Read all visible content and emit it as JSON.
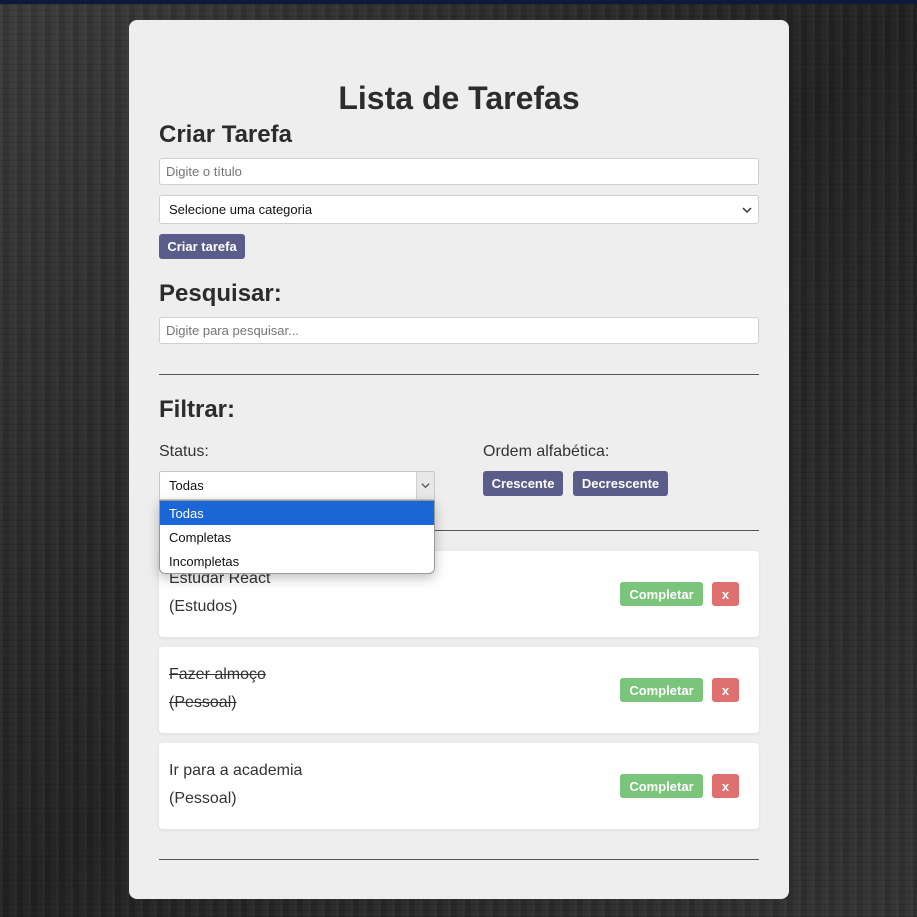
{
  "app": {
    "title": "Lista de Tarefas"
  },
  "create": {
    "heading": "Criar Tarefa",
    "title_placeholder": "Digite o título",
    "category_selected": "Selecione uma categoria",
    "button_label": "Criar tarefa"
  },
  "search": {
    "heading": "Pesquisar:",
    "placeholder": "Digite para pesquisar..."
  },
  "filter": {
    "heading": "Filtrar:",
    "status_label": "Status:",
    "status_selected": "Todas",
    "status_options": [
      "Todas",
      "Completas",
      "Incompletas"
    ],
    "sort_label": "Ordem alfabética:",
    "sort_asc_label": "Crescente",
    "sort_desc_label": "Decrescente"
  },
  "tasks": [
    {
      "name": "Estudar React",
      "category": "(Estudos)",
      "completed": false,
      "complete_label": "Completar",
      "delete_label": "x"
    },
    {
      "name": "Fazer almoço",
      "category": "(Pessoal)",
      "completed": true,
      "complete_label": "Completar",
      "delete_label": "x"
    },
    {
      "name": "Ir para a academia",
      "category": "(Pessoal)",
      "completed": false,
      "complete_label": "Completar",
      "delete_label": "x"
    }
  ],
  "colors": {
    "primary_button": "#5a5d8a",
    "complete_button": "#7bc47b",
    "delete_button": "#e07070",
    "selected_option": "#1a66d6"
  }
}
